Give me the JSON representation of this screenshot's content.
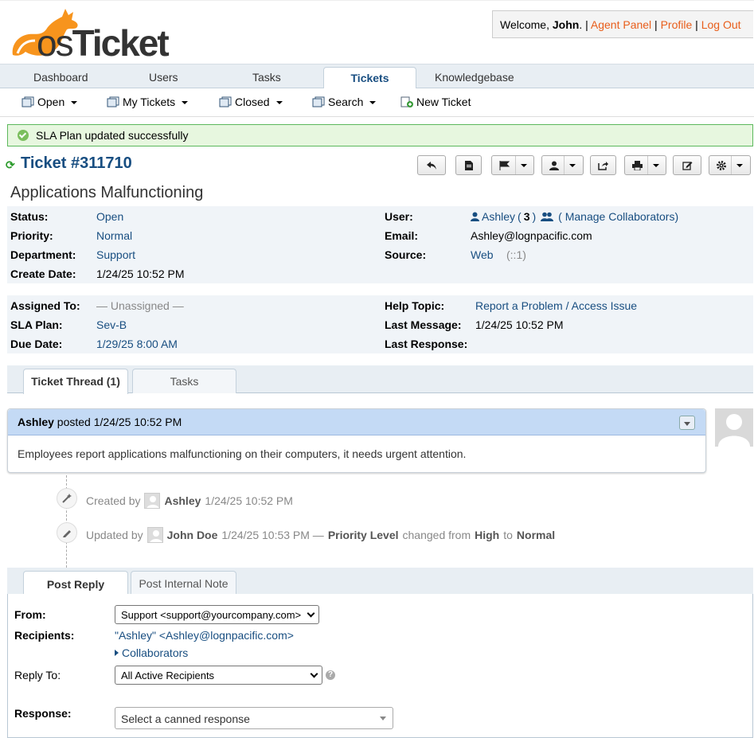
{
  "brand": {
    "logo_text_os": "os",
    "logo_text_ticket": "Ticket",
    "colors": {
      "orange": "#f7941d",
      "dark": "#333333"
    }
  },
  "welcome": {
    "prefix": "Welcome, ",
    "name": "John",
    "suffix": ".",
    "sep": " | ",
    "agent_panel": "Agent Panel",
    "profile": "Profile",
    "logout": "Log Out"
  },
  "nav": {
    "dashboard": "Dashboard",
    "users": "Users",
    "tasks": "Tasks",
    "tickets": "Tickets",
    "knowledgebase": "Knowledgebase"
  },
  "subnav": {
    "open": "Open",
    "my_tickets": "My Tickets",
    "closed": "Closed",
    "search": "Search",
    "new_ticket": "New Ticket"
  },
  "message": "SLA Plan updated successfully",
  "ticket": {
    "number": "Ticket #311710",
    "subject": "Applications Malfunctioning",
    "labels": {
      "status": "Status:",
      "priority": "Priority:",
      "department": "Department:",
      "create_date": "Create Date:",
      "user": "User:",
      "email": "Email:",
      "source": "Source:",
      "assigned_to": "Assigned To:",
      "sla_plan": "SLA Plan:",
      "due_date": "Due Date:",
      "help_topic": "Help Topic:",
      "last_message": "Last Message:",
      "last_response": "Last Response:"
    },
    "status": "Open",
    "priority": "Normal",
    "department": "Support",
    "create_date": "1/24/25 10:52 PM",
    "user_name": "Ashley",
    "user_count_open": " (",
    "user_count": "3",
    "user_count_close": ")",
    "manage_collaborators": "( Manage Collaborators)",
    "email": "Ashley@lognpacific.com",
    "source": "Web",
    "source_ip": "(::1)",
    "assigned_to": "— Unassigned —",
    "sla_plan": "Sev-B",
    "due_date": "1/29/25 8:00 AM",
    "help_topic": "Report a Problem / Access Issue",
    "last_message": "1/24/25 10:52 PM",
    "last_response": ""
  },
  "thread_tabs": {
    "thread": "Ticket Thread (1)",
    "tasks": "Tasks"
  },
  "entry": {
    "author": "Ashley",
    "posted": " posted 1/24/25 10:52 PM",
    "body": "Employees report applications malfunctioning on their computers, it needs urgent attention."
  },
  "events": [
    {
      "prefix": "Created by",
      "who": "Ashley",
      "when": "1/24/25 10:52 PM",
      "rest_a": "",
      "field": "",
      "rest_b": "",
      "from": "",
      "rest_c": "",
      "to": ""
    },
    {
      "prefix": "Updated by",
      "who": "John Doe",
      "when": "1/24/25 10:53 PM —",
      "rest_a": "",
      "field": "Priority Level",
      "rest_b": "changed from",
      "from": "High",
      "rest_c": "to",
      "to": "Normal"
    }
  ],
  "reply_tabs": {
    "post_reply": "Post Reply",
    "internal_note": "Post Internal Note"
  },
  "reply": {
    "from_label": "From:",
    "from_value": "Support <support@yourcompany.com>",
    "recipients_label": "Recipients:",
    "recipients_value": "\"Ashley\" <Ashley@lognpacific.com>",
    "collaborators": "Collaborators",
    "reply_to_label": "Reply To:",
    "reply_to_value": "All Active Recipients",
    "response_label": "Response:",
    "canned_placeholder": "Select a canned response"
  }
}
